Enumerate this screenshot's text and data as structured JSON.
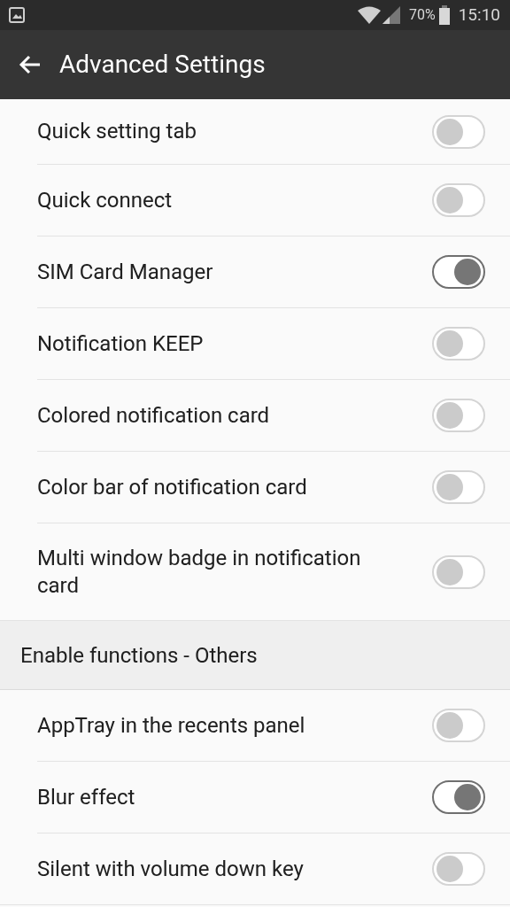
{
  "status_bar": {
    "battery": "70%",
    "time": "15:10"
  },
  "app_bar": {
    "title": "Advanced Settings"
  },
  "sections": [
    {
      "items": [
        {
          "label": "Quick setting tab",
          "on": false
        },
        {
          "label": "Quick connect",
          "on": false
        },
        {
          "label": "SIM Card Manager",
          "on": true
        },
        {
          "label": "Notification KEEP",
          "on": false
        },
        {
          "label": "Colored notification card",
          "on": false
        },
        {
          "label": "Color bar of notification card",
          "on": false
        },
        {
          "label": "Multi window badge in notification card",
          "on": false
        }
      ]
    },
    {
      "header": "Enable functions - Others",
      "items": [
        {
          "label": "AppTray in the recents panel",
          "on": false
        },
        {
          "label": "Blur effect",
          "on": true
        },
        {
          "label": "Silent with volume down key",
          "on": false
        }
      ]
    }
  ]
}
